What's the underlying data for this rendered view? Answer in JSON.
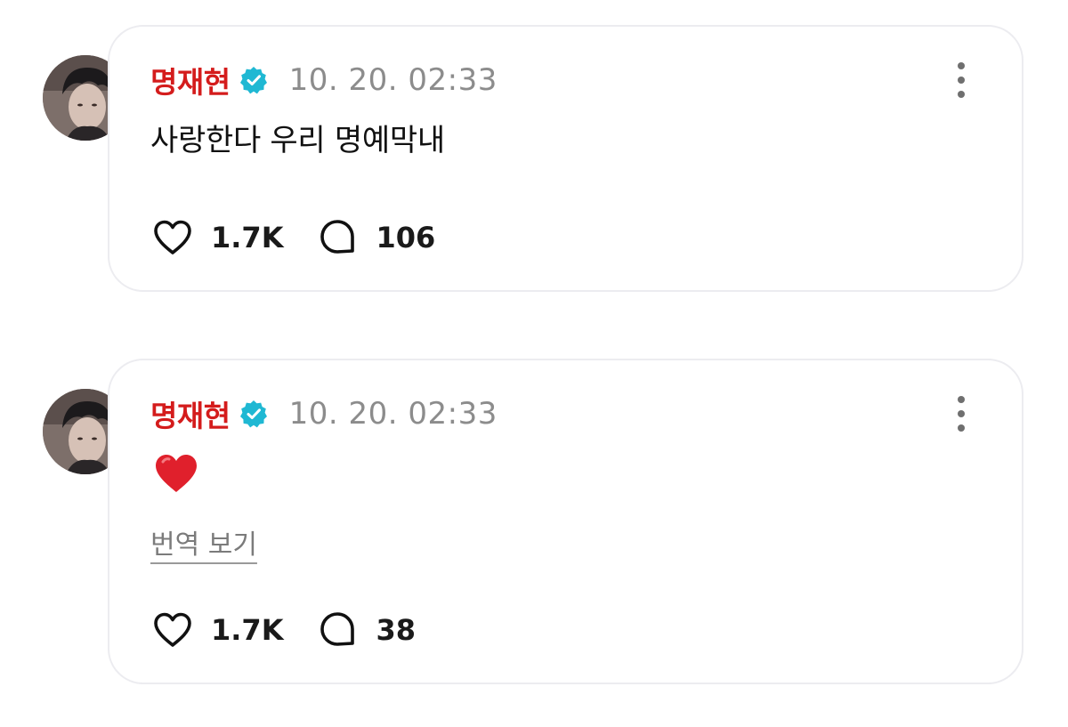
{
  "posts": [
    {
      "author": "명재현",
      "timestamp": "10. 20. 02:33",
      "text": "사랑한다 우리 명예막내",
      "likes": "1.7K",
      "comments": "106"
    },
    {
      "author": "명재현",
      "timestamp": "10. 20. 02:33",
      "emoji": "red-heart-emoji",
      "translate_label": "번역 보기",
      "likes": "1.7K",
      "comments": "38"
    }
  ],
  "colors": {
    "author_name": "#d41c1c",
    "verified_badge": "#1fb8d3",
    "timestamp": "#8c8c8c",
    "card_border": "#ececf0"
  },
  "icons": [
    "verified-badge-icon",
    "more-options-icon",
    "heart-outline-icon",
    "comment-bubble-icon"
  ]
}
